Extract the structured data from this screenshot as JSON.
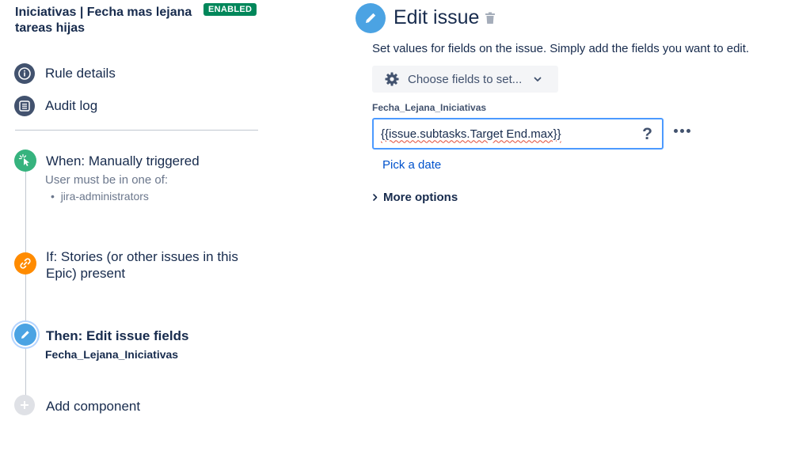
{
  "rule": {
    "title": "Iniciativas | Fecha mas lejana tareas hijas",
    "status_badge": "ENABLED"
  },
  "nav": {
    "rule_details": "Rule details",
    "audit_log": "Audit log"
  },
  "steps": {
    "trigger": {
      "title": "When: Manually triggered",
      "subtitle": "User must be in one of:",
      "bullet": "jira-administrators"
    },
    "condition": {
      "title_line1": "If: Stories (or other issues in this",
      "title_line2": "Epic) present"
    },
    "action": {
      "title": "Then: Edit issue fields",
      "subtitle": "Fecha_Lejana_Iniciativas"
    },
    "add_component": "Add component"
  },
  "editor": {
    "title": "Edit issue",
    "description": "Set values for fields on the issue. Simply add the fields you want to edit.",
    "choose_fields_label": "Choose fields to set...",
    "field_label": "Fecha_Lejana_Iniciativas",
    "field_value": "{{issue.subtasks.Target End.max}}",
    "help_symbol": "?",
    "pick_date": "Pick a date",
    "more_options": "More options"
  },
  "colors": {
    "badge_green": "#00875A",
    "edit_blue": "#4BA3E3",
    "trigger_green": "#36B37E",
    "condition_orange": "#FF8B00",
    "link_blue": "#0052CC",
    "focus_border": "#4C9AFF"
  },
  "icons": {
    "rule_details": "info-icon",
    "audit_log": "list-icon",
    "trigger": "cursor-click-icon",
    "condition": "link-icon",
    "action": "pencil-icon",
    "add": "plus-icon",
    "editor": "pencil-icon",
    "delete": "trash-icon",
    "choose": "gear-icon",
    "dropdown": "chevron-down-icon",
    "more": "more-dots-icon",
    "expand": "chevron-right-icon"
  }
}
